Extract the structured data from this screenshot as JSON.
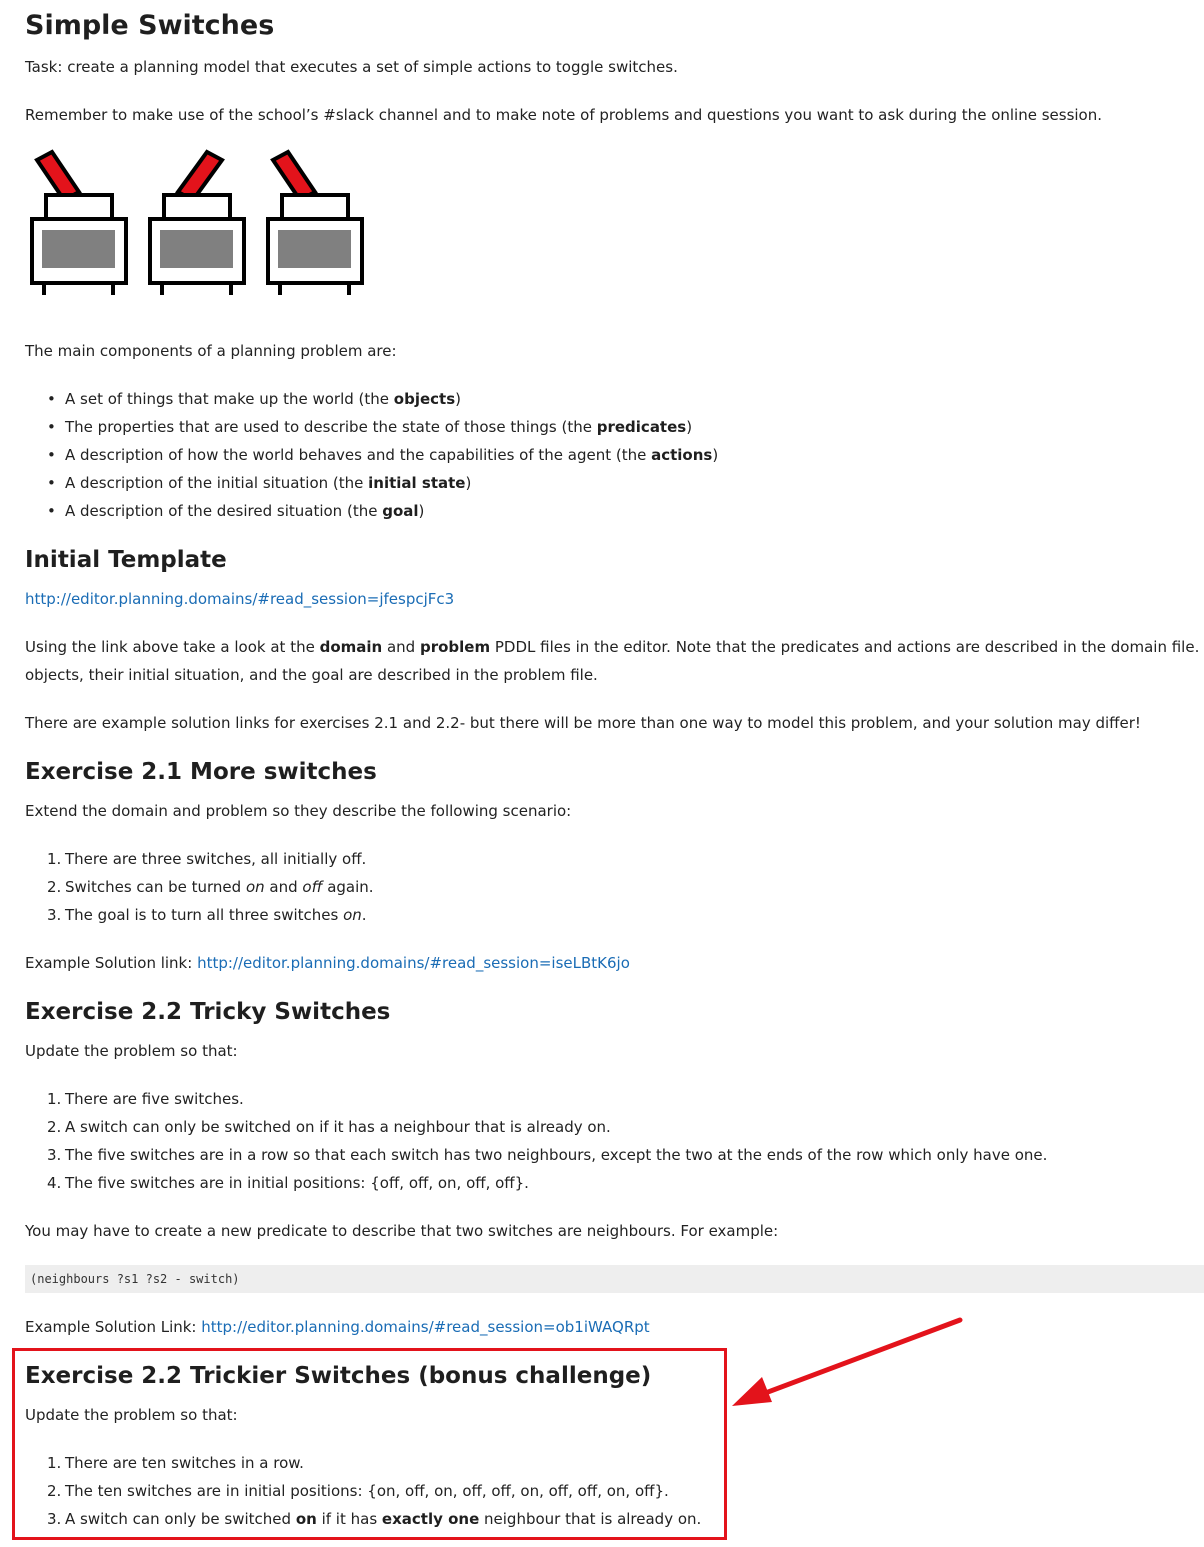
{
  "title": "Simple Switches",
  "task": "Task: create a planning model that executes a set of simple actions to toggle switches.",
  "reminder": "Remember to make use of the school’s #slack channel and to make note of problems and questions you want to ask during the online session.",
  "components_intro": "The main components of a planning problem are:",
  "components": [
    {
      "pre": "A set of things that make up the world (the ",
      "bold": "objects",
      "post": ")"
    },
    {
      "pre": "The properties that are used to describe the state of those things (the ",
      "bold": "predicates",
      "post": ")"
    },
    {
      "pre": "A description of how the world behaves and the capabilities of the agent (the ",
      "bold": "actions",
      "post": ")"
    },
    {
      "pre": "A description of the initial situation (the ",
      "bold": "initial state",
      "post": ")"
    },
    {
      "pre": "A description of the desired situation (the ",
      "bold": "goal",
      "post": ")"
    }
  ],
  "initial_template": {
    "heading": "Initial Template",
    "link": "http://editor.planning.domains/#read_session=jfespcjFc3",
    "para1_a": "Using the link above take a look at the ",
    "para1_b": "domain",
    "para1_c": " and ",
    "para1_d": "problem",
    "para1_e": " PDDL files in the editor. Note that the predicates and actions are described in the domain file. The",
    "para1_line2": "objects, their initial situation, and the goal are described in the problem file.",
    "para2": "There are example solution links for exercises 2.1 and 2.2- but there will be more than one way to model this problem, and your solution may differ!"
  },
  "ex21": {
    "heading": "Exercise 2.1 More switches",
    "intro": "Extend the domain and problem so they describe the following scenario:",
    "item1": "There are three switches, all initially off.",
    "item2_a": "Switches can be turned ",
    "item2_b": "on",
    "item2_c": " and ",
    "item2_d": "off",
    "item2_e": " again.",
    "item3_a": "The goal is to turn all three switches ",
    "item3_b": "on",
    "item3_c": ".",
    "solution_label": "Example Solution link: ",
    "solution_link": "http://editor.planning.domains/#read_session=iseLBtK6jo"
  },
  "ex22": {
    "heading": "Exercise 2.2 Tricky Switches",
    "intro": "Update the problem so that:",
    "items": [
      "There are five switches.",
      "A switch can only be switched on if it has a neighbour that is already on.",
      "The five switches are in a row so that each switch has two neighbours, except the two at the ends of the row which only have one.",
      "The five switches are in initial positions: {off, off, on, off, off}."
    ],
    "predicate_note": "You may have to create a new predicate to describe that two switches are neighbours. For example:",
    "code": "(neighbours ?s1 ?s2 - switch)",
    "solution_label": "Example Solution Link: ",
    "solution_link": "http://editor.planning.domains/#read_session=ob1iWAQRpt"
  },
  "ex22b": {
    "heading": "Exercise 2.2 Trickier Switches (bonus challenge)",
    "intro": "Update the problem so that:",
    "item1": "There are ten switches in a row.",
    "item2": "The ten switches are in initial positions: {on, off, on, off, off, on, off, off, on, off}.",
    "item3_a": "A switch can only be switched ",
    "item3_b": "on",
    "item3_c": " if it has ",
    "item3_d": "exactly one",
    "item3_e": " neighbour that is already on."
  },
  "colors": {
    "link": "#1a6cb5",
    "highlight": "#e3131b",
    "switch_lever": "#e3131b",
    "switch_panel": "#808080"
  }
}
